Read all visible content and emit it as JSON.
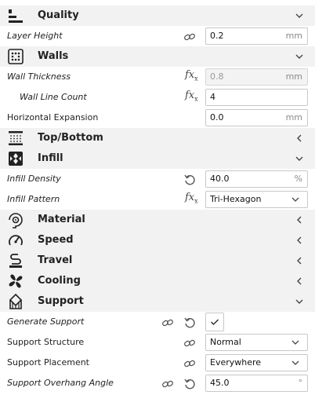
{
  "categories": {
    "quality": "Quality",
    "walls": "Walls",
    "topbottom": "Top/Bottom",
    "infill": "Infill",
    "material": "Material",
    "speed": "Speed",
    "travel": "Travel",
    "cooling": "Cooling",
    "support": "Support"
  },
  "settings": {
    "layer_height": {
      "label": "Layer Height",
      "value": "0.2",
      "unit": "mm"
    },
    "wall_thickness": {
      "label": "Wall Thickness",
      "value": "0.8",
      "unit": "mm"
    },
    "wall_line_count": {
      "label": "Wall Line Count",
      "value": "4"
    },
    "horizontal_expansion": {
      "label": "Horizontal Expansion",
      "value": "0.0",
      "unit": "mm"
    },
    "infill_density": {
      "label": "Infill Density",
      "value": "40.0",
      "unit": "%"
    },
    "infill_pattern": {
      "label": "Infill Pattern",
      "value": "Tri-Hexagon"
    },
    "generate_support": {
      "label": "Generate Support",
      "checked": true
    },
    "support_structure": {
      "label": "Support Structure",
      "value": "Normal"
    },
    "support_placement": {
      "label": "Support Placement",
      "value": "Everywhere"
    },
    "support_overhang_angle": {
      "label": "Support Overhang Angle",
      "value": "45.0",
      "unit": "°"
    }
  },
  "icons": {
    "function": "fx",
    "function_sub": "x"
  }
}
